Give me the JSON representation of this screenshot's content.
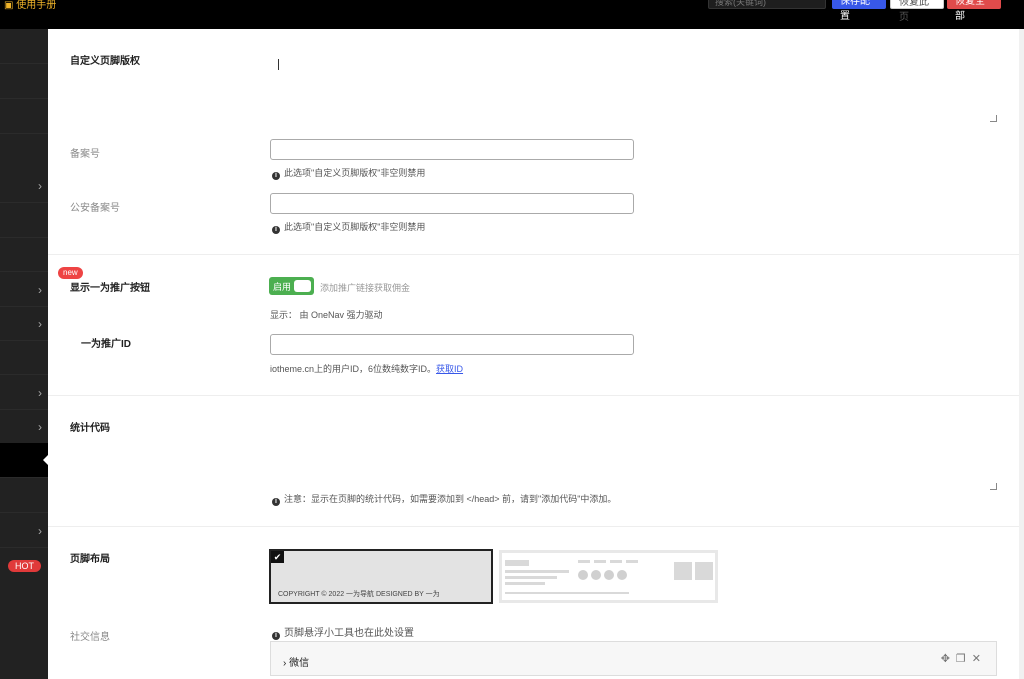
{
  "topbar": {
    "manual_label": "使用手册",
    "search_placeholder": "搜索(关键词)",
    "save_label": "保存配置",
    "restore_page_label": "恢复此页",
    "restore_all_label": "恢复全部"
  },
  "sidebar": {
    "hot_badge": "HOT"
  },
  "form": {
    "copyright": {
      "label": "自定义页脚版权",
      "value": ""
    },
    "icp": {
      "label": "备案号",
      "value": "",
      "hint": "此选项\"自定义页脚版权\"非空则禁用"
    },
    "police": {
      "label": "公安备案号",
      "value": "",
      "hint": "此选项\"自定义页脚版权\"非空则禁用"
    },
    "promo": {
      "badge": "new",
      "label": "显示一为推广按钮",
      "toggle_label": "启用",
      "toggle_desc": "添加推广链接获取佣金",
      "display_text": "显示： 由 OneNav 强力驱动"
    },
    "promo_id": {
      "label": "一为推广ID",
      "value": "",
      "hint_prefix": "iotheme.cn上的用户ID，6位数纯数字ID。",
      "hint_link": "获取ID"
    },
    "stats": {
      "label": "统计代码",
      "value": "",
      "hint": "注意：显示在页脚的统计代码，如需要添加到 </head> 前，请到\"添加代码\"中添加。"
    },
    "footer_layout": {
      "label": "页脚布局",
      "option1_copyright": "COPYRIGHT © 2022 一为导航 DESIGNED BY 一为"
    },
    "social": {
      "label": "社交信息",
      "hint": "页脚悬浮小工具也在此处设置",
      "item_title": "微信"
    }
  }
}
